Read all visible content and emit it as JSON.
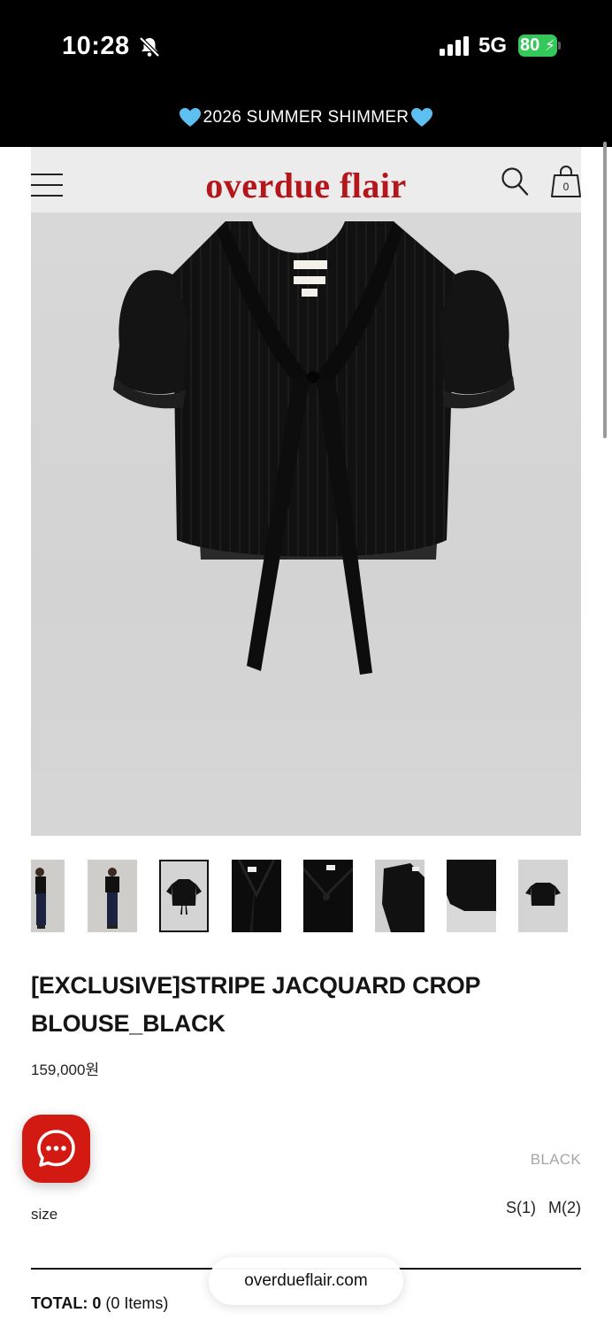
{
  "status_bar": {
    "time": "10:28",
    "network": "5G",
    "battery": "80",
    "icons": [
      "bell-slash-icon",
      "signal-icon",
      "battery-charging-icon"
    ]
  },
  "promo": {
    "text": "2026 SUMMER SHIMMER",
    "icon": "blue-heart-icon",
    "icon_color": "#5ec0f0"
  },
  "header": {
    "logo": "overdue flair",
    "logo_color": "#b5161b",
    "cart_count": "0",
    "icons": [
      "menu-icon",
      "search-icon",
      "shopping-bag-icon"
    ]
  },
  "gallery": {
    "thumbnail_count": 8,
    "active_thumbnail": 3
  },
  "product": {
    "title": "[EXCLUSIVE]STRIPE JACQUARD CROP BLOUSE_BLACK",
    "price": "159,000원",
    "color": "BLACK",
    "size_label": "size",
    "sizes": [
      "S(1)",
      "M(2)"
    ]
  },
  "total": {
    "label": "TOTAL:",
    "count": "0",
    "items": "(0 Items)"
  },
  "browser": {
    "url": "overdueflair.com"
  },
  "chat": {
    "icon": "chat-bubble-icon",
    "color": "#d31a12"
  }
}
